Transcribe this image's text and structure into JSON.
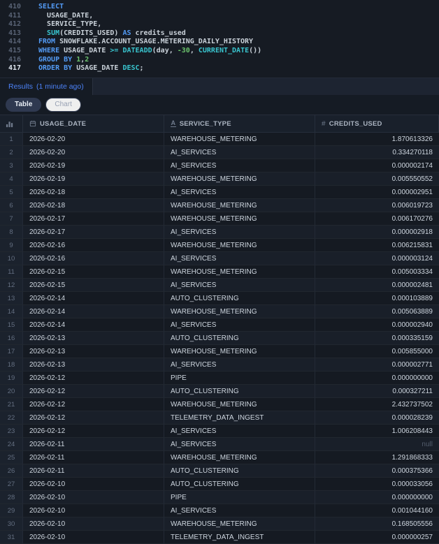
{
  "colors": {
    "background": "#161b23",
    "panel": "#151b24",
    "accent_blue": "#4c82f7",
    "keyword": "#539bf5",
    "function": "#39c5cf",
    "number_literal": "#6bc46d",
    "identifier": "#c9d1d9",
    "selected_pill_bg": "#2f3950",
    "null_text": "#525c6c"
  },
  "editor": {
    "lines": [
      {
        "num": "410",
        "active": false,
        "tokens": [
          [
            "kw",
            "SELECT"
          ]
        ]
      },
      {
        "num": "411",
        "active": false,
        "tokens": [
          [
            "plain",
            "  "
          ],
          [
            "id",
            "USAGE_DATE"
          ],
          [
            "plain",
            ","
          ]
        ]
      },
      {
        "num": "412",
        "active": false,
        "tokens": [
          [
            "plain",
            "  "
          ],
          [
            "id",
            "SERVICE_TYPE"
          ],
          [
            "plain",
            ","
          ]
        ]
      },
      {
        "num": "413",
        "active": false,
        "tokens": [
          [
            "plain",
            "  "
          ],
          [
            "fn",
            "SUM"
          ],
          [
            "plain",
            "("
          ],
          [
            "id",
            "CREDITS_USED"
          ],
          [
            "plain",
            ") "
          ],
          [
            "kw",
            "AS"
          ],
          [
            "plain",
            " "
          ],
          [
            "id",
            "credits_used"
          ]
        ]
      },
      {
        "num": "414",
        "active": false,
        "tokens": [
          [
            "kw",
            "FROM"
          ],
          [
            "plain",
            " "
          ],
          [
            "id",
            "SNOWFLAKE.ACCOUNT_USAGE.METERING_DAILY_HISTORY"
          ]
        ]
      },
      {
        "num": "415",
        "active": false,
        "tokens": [
          [
            "kw",
            "WHERE"
          ],
          [
            "plain",
            " "
          ],
          [
            "id",
            "USAGE_DATE"
          ],
          [
            "plain",
            " "
          ],
          [
            "op",
            ">="
          ],
          [
            "plain",
            " "
          ],
          [
            "fn",
            "DATEADD"
          ],
          [
            "plain",
            "("
          ],
          [
            "id",
            "day"
          ],
          [
            "plain",
            ", "
          ],
          [
            "num",
            "-30"
          ],
          [
            "plain",
            ", "
          ],
          [
            "fn",
            "CURRENT_DATE"
          ],
          [
            "plain",
            "())"
          ]
        ]
      },
      {
        "num": "416",
        "active": false,
        "tokens": [
          [
            "kw",
            "GROUP BY"
          ],
          [
            "plain",
            " "
          ],
          [
            "num",
            "1"
          ],
          [
            "plain",
            ","
          ],
          [
            "num",
            "2"
          ]
        ]
      },
      {
        "num": "417",
        "active": true,
        "tokens": [
          [
            "kw",
            "ORDER BY"
          ],
          [
            "plain",
            " "
          ],
          [
            "id",
            "USAGE_DATE"
          ],
          [
            "plain",
            " "
          ],
          [
            "fn",
            "DESC"
          ],
          [
            "plain",
            ";"
          ]
        ]
      }
    ]
  },
  "results": {
    "tab_label": "Results",
    "tab_time": "(1 minute ago)"
  },
  "toolbar": {
    "table_label": "Table",
    "chart_label": "Chart"
  },
  "table": {
    "columns": [
      {
        "label": "",
        "icon": "bar-chart-icon"
      },
      {
        "label": "USAGE_DATE",
        "icon": "calendar-icon"
      },
      {
        "label": "SERVICE_TYPE",
        "icon": "text-type-icon"
      },
      {
        "label": "CREDITS_USED",
        "icon": "number-type-icon"
      }
    ],
    "rows": [
      {
        "n": "1",
        "date": "2026-02-20",
        "service": "WAREHOUSE_METERING",
        "credits": "1.870613326"
      },
      {
        "n": "2",
        "date": "2026-02-20",
        "service": "AI_SERVICES",
        "credits": "0.334270118"
      },
      {
        "n": "3",
        "date": "2026-02-19",
        "service": "AI_SERVICES",
        "credits": "0.000002174"
      },
      {
        "n": "4",
        "date": "2026-02-19",
        "service": "WAREHOUSE_METERING",
        "credits": "0.005550552"
      },
      {
        "n": "5",
        "date": "2026-02-18",
        "service": "AI_SERVICES",
        "credits": "0.000002951"
      },
      {
        "n": "6",
        "date": "2026-02-18",
        "service": "WAREHOUSE_METERING",
        "credits": "0.006019723"
      },
      {
        "n": "7",
        "date": "2026-02-17",
        "service": "WAREHOUSE_METERING",
        "credits": "0.006170276"
      },
      {
        "n": "8",
        "date": "2026-02-17",
        "service": "AI_SERVICES",
        "credits": "0.000002918"
      },
      {
        "n": "9",
        "date": "2026-02-16",
        "service": "WAREHOUSE_METERING",
        "credits": "0.006215831"
      },
      {
        "n": "10",
        "date": "2026-02-16",
        "service": "AI_SERVICES",
        "credits": "0.000003124"
      },
      {
        "n": "11",
        "date": "2026-02-15",
        "service": "WAREHOUSE_METERING",
        "credits": "0.005003334"
      },
      {
        "n": "12",
        "date": "2026-02-15",
        "service": "AI_SERVICES",
        "credits": "0.000002481"
      },
      {
        "n": "13",
        "date": "2026-02-14",
        "service": "AUTO_CLUSTERING",
        "credits": "0.000103889"
      },
      {
        "n": "14",
        "date": "2026-02-14",
        "service": "WAREHOUSE_METERING",
        "credits": "0.005063889"
      },
      {
        "n": "15",
        "date": "2026-02-14",
        "service": "AI_SERVICES",
        "credits": "0.000002940"
      },
      {
        "n": "16",
        "date": "2026-02-13",
        "service": "AUTO_CLUSTERING",
        "credits": "0.000335159"
      },
      {
        "n": "17",
        "date": "2026-02-13",
        "service": "WAREHOUSE_METERING",
        "credits": "0.005855000"
      },
      {
        "n": "18",
        "date": "2026-02-13",
        "service": "AI_SERVICES",
        "credits": "0.000002771"
      },
      {
        "n": "19",
        "date": "2026-02-12",
        "service": "PIPE",
        "credits": "0.000000000"
      },
      {
        "n": "20",
        "date": "2026-02-12",
        "service": "AUTO_CLUSTERING",
        "credits": "0.000327211"
      },
      {
        "n": "21",
        "date": "2026-02-12",
        "service": "WAREHOUSE_METERING",
        "credits": "2.432737502"
      },
      {
        "n": "22",
        "date": "2026-02-12",
        "service": "TELEMETRY_DATA_INGEST",
        "credits": "0.000028239"
      },
      {
        "n": "23",
        "date": "2026-02-12",
        "service": "AI_SERVICES",
        "credits": "1.006208443"
      },
      {
        "n": "24",
        "date": "2026-02-11",
        "service": "AI_SERVICES",
        "credits": "null"
      },
      {
        "n": "25",
        "date": "2026-02-11",
        "service": "WAREHOUSE_METERING",
        "credits": "1.291868333"
      },
      {
        "n": "26",
        "date": "2026-02-11",
        "service": "AUTO_CLUSTERING",
        "credits": "0.000375366"
      },
      {
        "n": "27",
        "date": "2026-02-10",
        "service": "AUTO_CLUSTERING",
        "credits": "0.000033056"
      },
      {
        "n": "28",
        "date": "2026-02-10",
        "service": "PIPE",
        "credits": "0.000000000"
      },
      {
        "n": "29",
        "date": "2026-02-10",
        "service": "AI_SERVICES",
        "credits": "0.001044160"
      },
      {
        "n": "30",
        "date": "2026-02-10",
        "service": "WAREHOUSE_METERING",
        "credits": "0.168505556"
      },
      {
        "n": "31",
        "date": "2026-02-10",
        "service": "TELEMETRY_DATA_INGEST",
        "credits": "0.000000257"
      }
    ]
  }
}
